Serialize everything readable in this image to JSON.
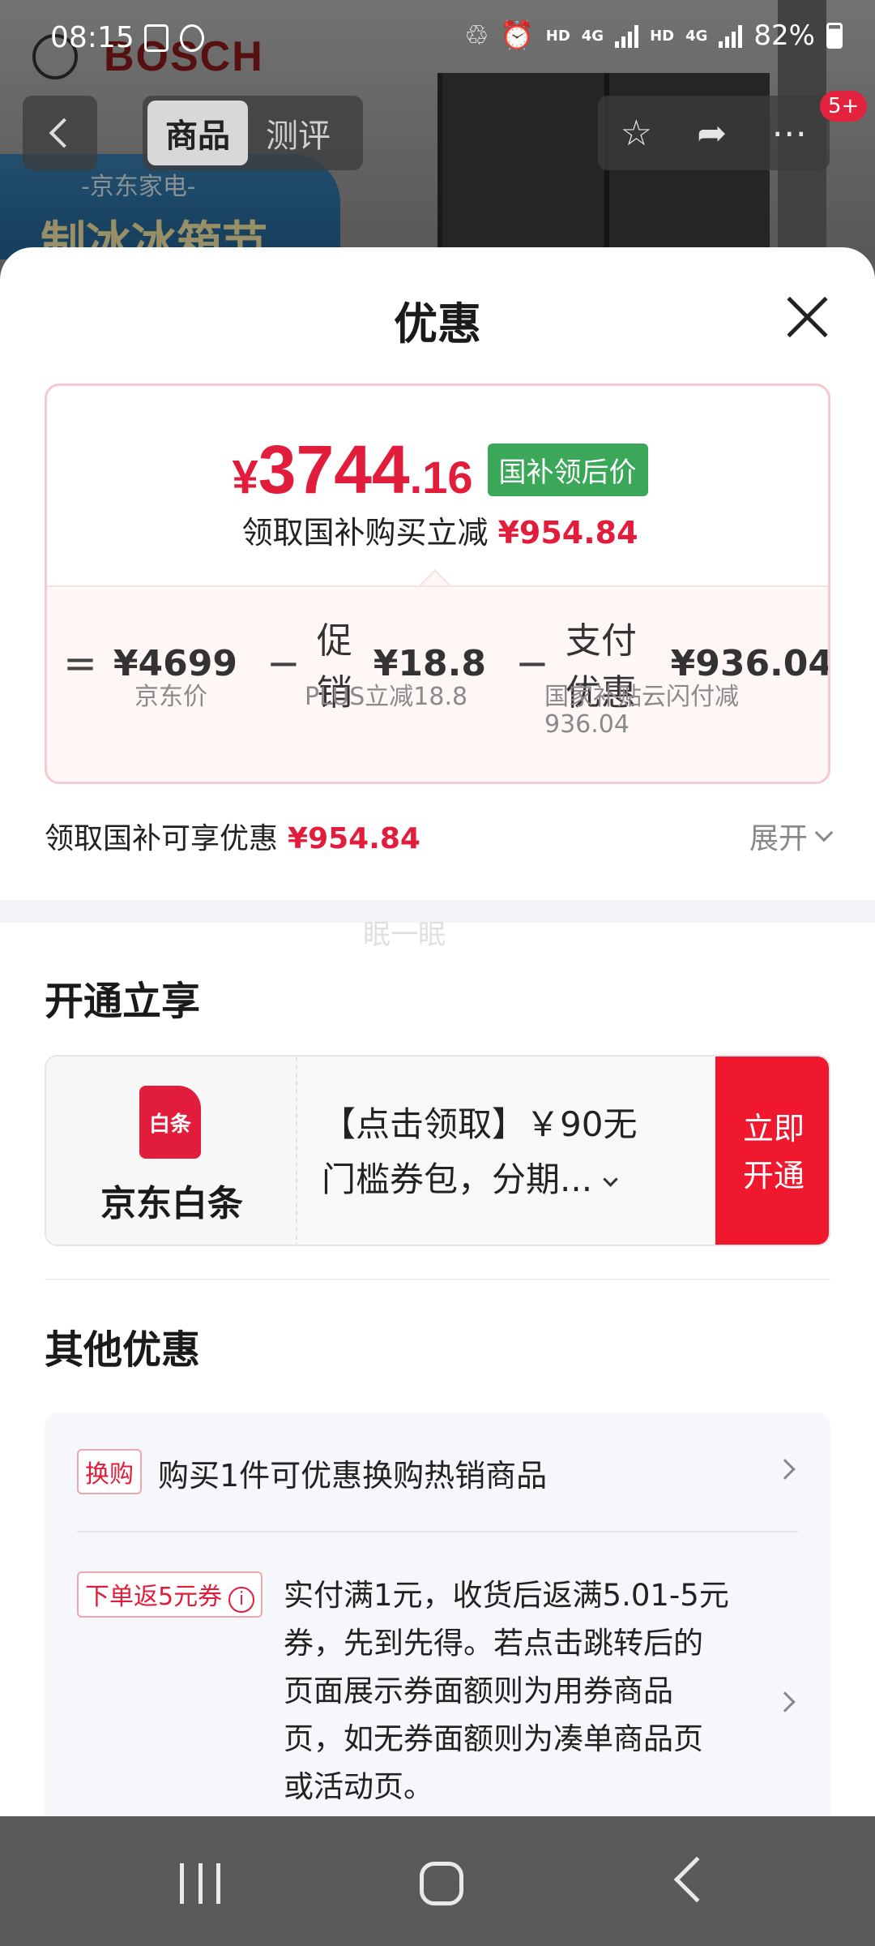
{
  "status_bar": {
    "time": "08:15",
    "network_hd_1": "HD",
    "network_4g_1": "4G",
    "network_hd_2": "HD",
    "network_4g_2": "4G",
    "battery": "82%"
  },
  "background": {
    "brand": "BOSCH",
    "promo_subtitle": "-京东家电-",
    "promo_title": "制冰冰箱节"
  },
  "top_nav": {
    "tabs": [
      {
        "label": "商品",
        "active": true
      },
      {
        "label": "测评",
        "active": false
      }
    ],
    "badge": "5+",
    "icons": [
      "back-icon",
      "star-icon",
      "share-icon",
      "more-icon"
    ]
  },
  "sheet": {
    "title": "优惠",
    "price": {
      "symbol": "¥",
      "integer": "3744",
      "decimal": ".16",
      "tag": "国补领后价",
      "subsidy_text": "领取国补购买立减",
      "subsidy_amount": "¥954.84"
    },
    "formula": {
      "eq": "=",
      "base_amount": "¥4699",
      "base_label": "京东价",
      "minus1": "−",
      "promo_name": "促销",
      "promo_amount": "¥18.8",
      "promo_label": "PLUS立减18.8",
      "minus2": "−",
      "pay_name": "支付优惠",
      "pay_amount": "¥936.04",
      "pay_label_1": "国家补贴云闪付减",
      "pay_label_2": "936.04"
    },
    "summary": {
      "text": "领取国补可享优惠",
      "amount": "¥954.84",
      "expand_label": "展开"
    },
    "watermark": "眠一眠",
    "open_section": {
      "title": "开通立享",
      "logo_text": "白条",
      "name": "京东白条",
      "desc_line1": "【点击领取】￥90无",
      "desc_line2": "门槛券包，分期...",
      "button_line1": "立即",
      "button_line2": "开通"
    },
    "other_section": {
      "title": "其他优惠",
      "items": [
        {
          "tag": "换购",
          "text": "购买1件可优惠换购热销商品"
        },
        {
          "tag": "下单返5元券",
          "text_lines": [
            "实付满1元，收货后返满5.01-5元",
            "券，先到先得。若点击跳转后的",
            "页面展示券面额则为用券商品",
            "页，如无券面额则为凑单商品页",
            "或活动页。"
          ]
        }
      ]
    }
  },
  "colors": {
    "accent_red": "#e21d3b",
    "tag_green": "#3aa858",
    "button_red": "#f0182e"
  }
}
